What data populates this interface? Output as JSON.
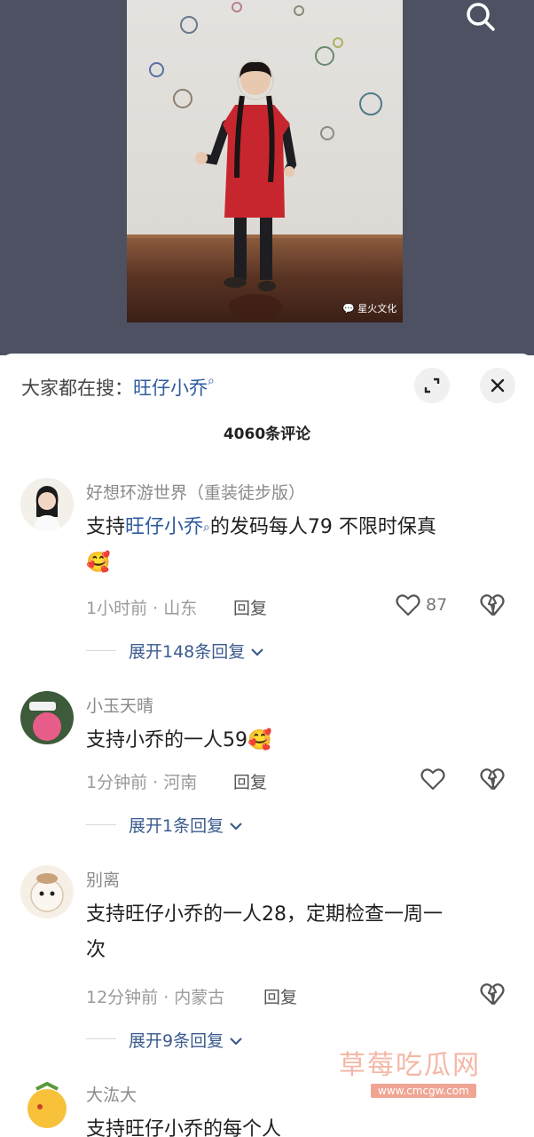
{
  "video": {
    "watermark": "星火文化"
  },
  "sheet": {
    "hot_search_prefix": "大家都在搜：",
    "hot_search_term": "旺仔小乔",
    "comment_count": "4060条评论"
  },
  "comments": [
    {
      "username": "好想环游世界（重装徒步版）",
      "text_prefix": "支持",
      "text_link": "旺仔小乔",
      "text_suffix": "的发码每人79  不限时保真",
      "emoji": "🥰",
      "time_location": "1小时前 · 山东",
      "reply_label": "回复",
      "likes": "87",
      "expand_label": "展开148条回复"
    },
    {
      "username": "小玉天晴",
      "text": "支持小乔的一人59",
      "emoji": "🥰",
      "time_location": "1分钟前 · 河南",
      "reply_label": "回复",
      "expand_label": "展开1条回复"
    },
    {
      "username": "别离",
      "text_line1": "支持旺仔小乔的一人28，定期检查一周一",
      "text_line2": "次",
      "time_location": "12分钟前 · 内蒙古",
      "reply_label": "回复",
      "expand_label": "展开9条回复"
    },
    {
      "username": "大汯大",
      "text": "支持旺仔小乔的每个人"
    }
  ],
  "site_watermark": {
    "title": "草莓吃瓜网",
    "url": "www.cmcgw.com"
  },
  "icons": {
    "search": "search-icon",
    "expand": "expand-icon",
    "close": "close-icon",
    "like": "heart-icon",
    "dislike": "broken-heart-icon",
    "chevron": "chevron-down-icon"
  },
  "colors": {
    "video_bg": "#4d5162",
    "link": "#2f5b9e",
    "expand_text": "#3b5b8e",
    "muted": "#9a9a9a"
  }
}
